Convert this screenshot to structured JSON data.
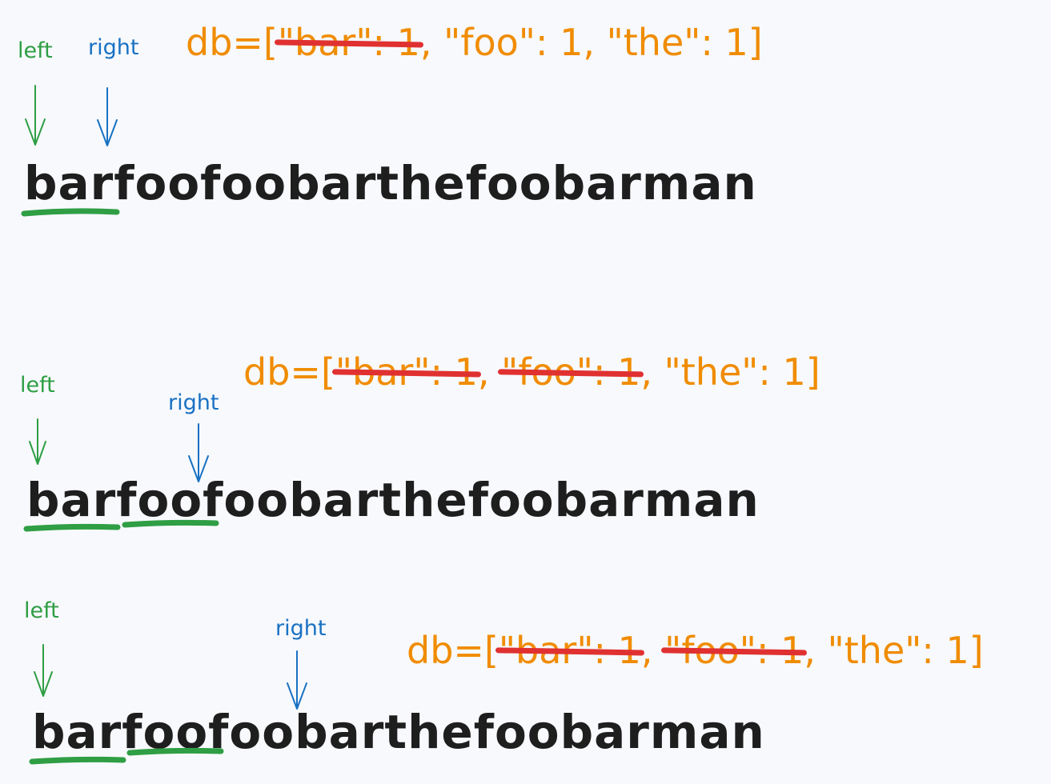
{
  "string": "barfoofoobarthefoobarman",
  "labels": {
    "left": "left",
    "right": "right"
  },
  "colors": {
    "left": "#2f9e44",
    "right": "#1971c2",
    "db": "#f08c00",
    "strike": "#e03131",
    "text": "#1e1e1e",
    "underline": "#2f9e44"
  },
  "steps": [
    {
      "db": {
        "prefix": "db=[",
        "e1": "\"bar\": 1",
        "sep1": ", ",
        "e2": "\"foo\": 1",
        "sep2": ", ",
        "e3": "\"the\": 1",
        "suffix": "]"
      },
      "struck": [
        "e1"
      ],
      "underlined_words": [
        "bar"
      ]
    },
    {
      "db": {
        "prefix": "db=[",
        "e1": "\"bar\": 1",
        "sep1": ", ",
        "e2": "\"foo\": 1",
        "sep2": ", ",
        "e3": "\"the\": 1",
        "suffix": "]"
      },
      "struck": [
        "e1",
        "e2"
      ],
      "underlined_words": [
        "bar",
        "foo"
      ]
    },
    {
      "db": {
        "prefix": "db=[",
        "e1": "\"bar\": 1",
        "sep1": ", ",
        "e2": "\"foo\": 1",
        "sep2": ", ",
        "e3": "\"the\": 1",
        "suffix": "]"
      },
      "struck": [
        "e1",
        "e2"
      ],
      "underlined_words": [
        "bar",
        "foo"
      ]
    }
  ]
}
